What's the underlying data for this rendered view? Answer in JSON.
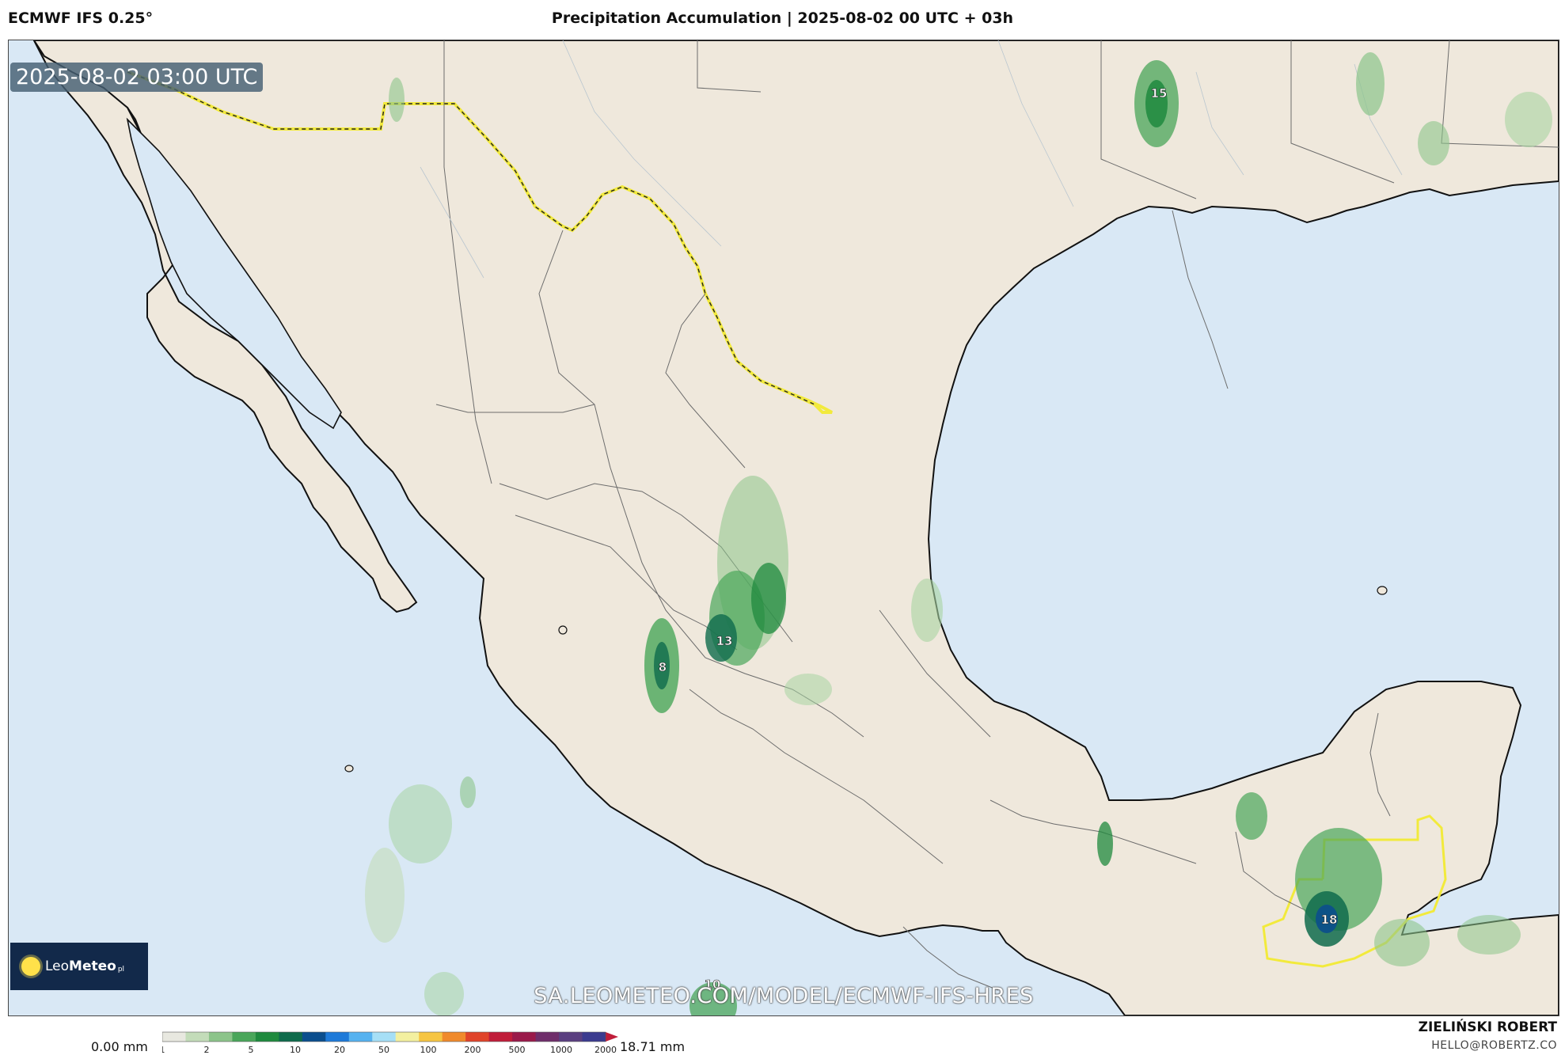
{
  "header": {
    "model": "ECMWF IFS 0.25°",
    "title": "Precipitation Accumulation | 2025-08-02 00 UTC + 03h"
  },
  "map": {
    "valid_time": "2025-08-02 03:00 UTC",
    "url": "SA.LEOMETEO.COM/MODEL/ECMWF-IFS-HRES",
    "logo": {
      "name": "Leo",
      "name_bold": "Meteo",
      "suffix": "pl"
    },
    "colors": {
      "ocean": "#d9e8f5",
      "land": "#efe8dc",
      "border": "#111111",
      "international_border": "#f2ea3c"
    },
    "labels": [
      {
        "value": "15",
        "region": "east Texas"
      },
      {
        "value": "13",
        "region": "Guanajuato"
      },
      {
        "value": "8",
        "region": "Jalisco"
      },
      {
        "value": "18",
        "region": "Guatemala"
      },
      {
        "value": "10",
        "region": "Pacific, south"
      }
    ]
  },
  "legend": {
    "min_label": "0.00 mm",
    "max_label": "18.71 mm",
    "ticks": [
      "1",
      "2",
      "5",
      "10",
      "20",
      "50",
      "100",
      "200",
      "500",
      "1000",
      "2000"
    ],
    "colors": [
      "#e8e8e0",
      "#c3dcb9",
      "#8cc48a",
      "#4aa65a",
      "#1f8a3e",
      "#0f6b4c",
      "#0b4e8d",
      "#1e7ad9",
      "#56b2f0",
      "#a6dff6",
      "#f3f0a0",
      "#f6c543",
      "#f08a2c",
      "#e0442a",
      "#c01d3a",
      "#9a1a4a",
      "#6f2e6a",
      "#5a3f80",
      "#3b3b8f"
    ]
  },
  "credit": {
    "author": "ZIELIŃSKI ROBERT",
    "email": "HELLO@ROBERTZ.CO"
  }
}
